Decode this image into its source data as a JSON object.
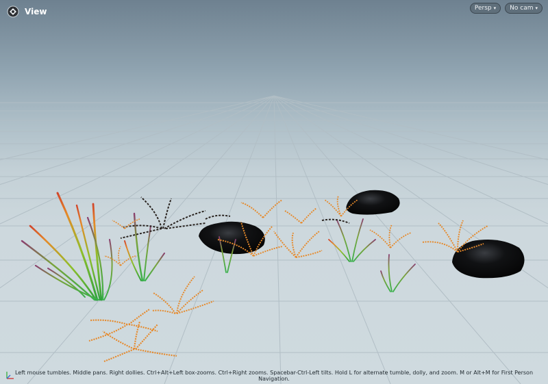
{
  "viewport": {
    "title": "View",
    "perspective_label": "Persp",
    "camera_label": "No cam",
    "hint": "Left mouse tumbles. Middle pans. Right dollies. Ctrl+Alt+Left box-zooms. Ctrl+Right zooms. Spacebar-Ctrl-Left tilts. Hold L for alternate tumble, dolly, and zoom. M or Alt+M for First Person Navigation."
  },
  "icons": {
    "app": "houdini-icon",
    "dropdown": "chevron-down-icon",
    "axes": "axis-gizmo-icon"
  },
  "colors": {
    "sky_top": "#6e8190",
    "ground": "#cfdadf",
    "grid_line": "#aebbc2",
    "fern_orange": "#e6892a",
    "grass_green": "#3fa24a",
    "rock": "#0c0c0d"
  }
}
